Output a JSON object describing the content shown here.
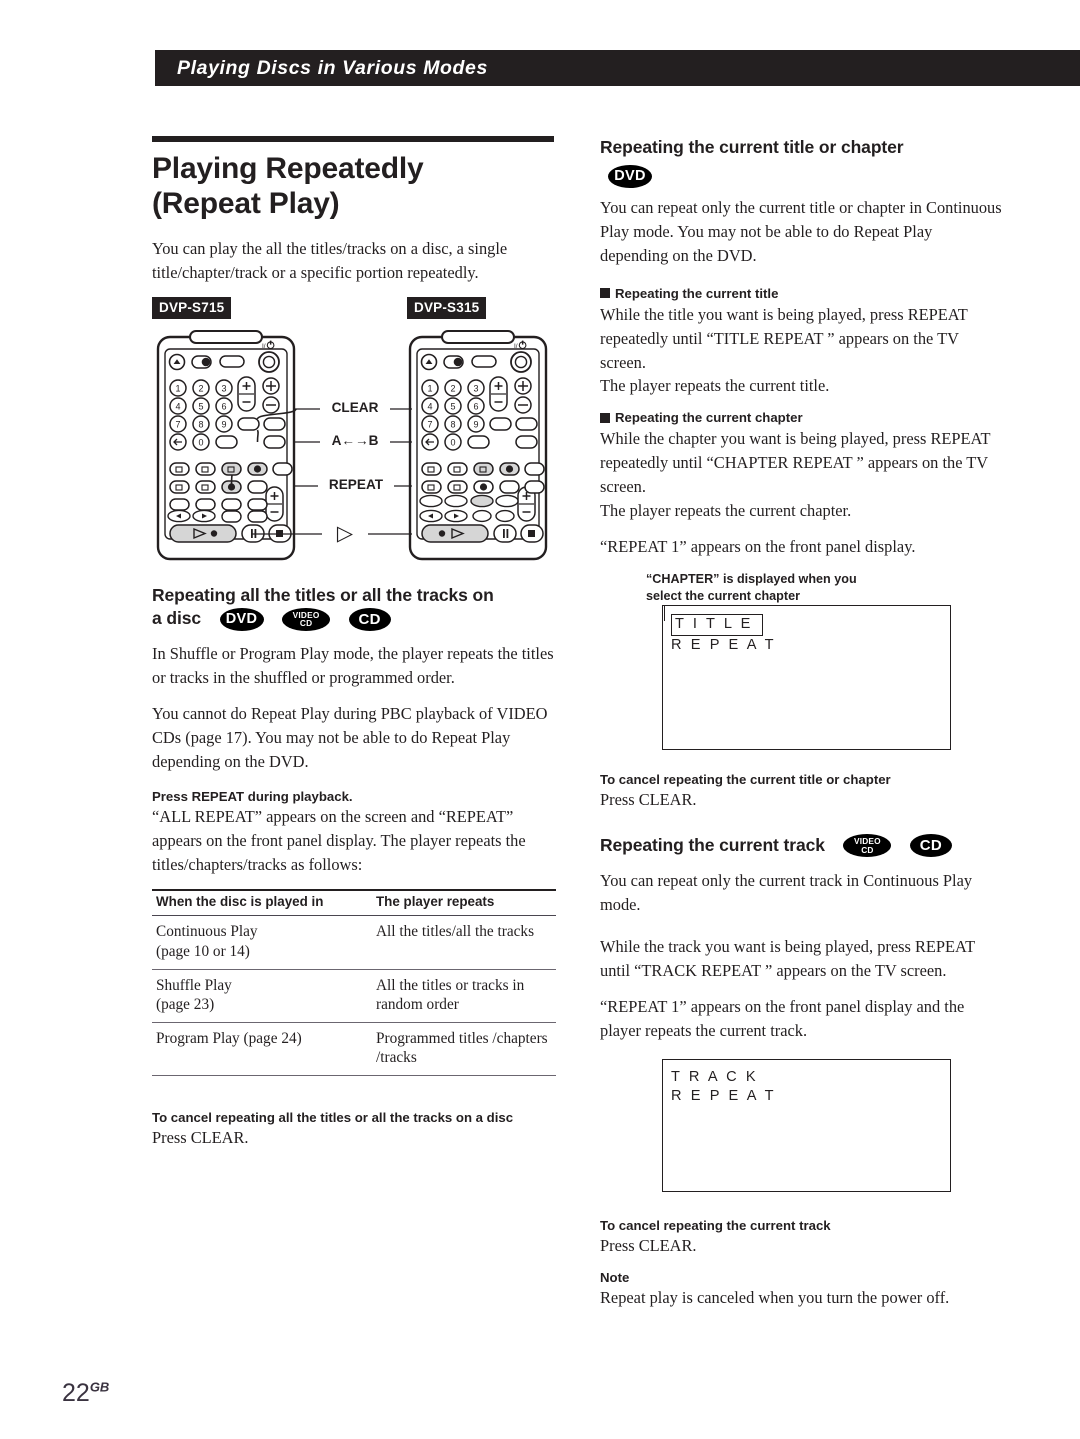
{
  "running_head": "Playing Discs in Various Modes",
  "page_number": "22",
  "page_number_suffix": "GB",
  "left": {
    "title_line1": "Playing Repeatedly",
    "title_line2": "(Repeat Play)",
    "intro": "You can play the all the titles/tracks on a disc, a single title/chapter/track or a specific portion repeatedly.",
    "model_left": "DVP-S715",
    "model_right": "DVP-S315",
    "callouts": [
      "CLEAR",
      "A←→B",
      "REPEAT",
      "▷"
    ],
    "section_all": {
      "heading_line1": "Repeating all the titles or all the tracks on",
      "heading_line2": "a disc",
      "badges": [
        "DVD",
        "VIDEO CD",
        "CD"
      ],
      "para1": "In Shuffle or Program Play mode, the player repeats the titles or tracks in the shuffled or programmed order.",
      "para2": "You cannot do Repeat Play during PBC playback of VIDEO CDs (page 17).  You may not be able to do Repeat Play depending on the DVD.",
      "lead": "Press REPEAT during playback.",
      "para3": "“ALL REPEAT” appears on the screen and “REPEAT” appears on the front panel display. The player repeats the titles/chapters/tracks as follows:",
      "table": {
        "headers": [
          "When the disc is played in",
          "The player repeats"
        ],
        "rows": [
          [
            "Continuous Play\n(page 10 or 14)",
            "All the titles/all the tracks"
          ],
          [
            "Shuffle Play\n(page 23)",
            "All the titles or tracks in\nrandom order"
          ],
          [
            "Program Play (page 24)",
            "Programmed titles /chapters\n/tracks"
          ]
        ]
      },
      "cancel_head": "To cancel repeating all the titles or all the tracks on a disc",
      "cancel_body": "Press CLEAR."
    }
  },
  "right": {
    "section_title_chapter": {
      "heading": "Repeating the current title or chapter",
      "badge": "DVD",
      "para1": "You can repeat only the current title or chapter in Continuous Play mode.  You may not be able to do Repeat Play depending on the DVD.",
      "bullet1_head": "Repeating the current title",
      "bullet1_body1": "While the title you want is being played, press REPEAT repeatedly until “TITLE REPEAT ” appears on the TV screen.",
      "bullet1_body2": "The player repeats the current title.",
      "bullet2_head": "Repeating the current chapter",
      "bullet2_body1": "While the chapter you want is being played, press REPEAT repeatedly until “CHAPTER REPEAT ” appears on the TV screen.",
      "bullet2_body2": "The player repeats the current chapter.",
      "para2": "“REPEAT 1” appears on the front panel display.",
      "callout_line1": "“CHAPTER” is displayed when you",
      "callout_line2": "select the current chapter",
      "osd_line1": "T I T L E",
      "osd_line2": "R E P E A T",
      "cancel_head": "To cancel repeating the current title or chapter",
      "cancel_body": "Press CLEAR."
    },
    "section_track": {
      "heading": "Repeating the current track",
      "badges": [
        "VIDEO CD",
        "CD"
      ],
      "para1": "You can repeat only the current track in Continuous Play mode.",
      "para2": "While the track you want is being played, press REPEAT until “TRACK REPEAT ” appears on the TV screen.",
      "para3": "“REPEAT 1” appears on the front panel display and the player repeats the current track.",
      "osd_line1": "T R A C K",
      "osd_line2": "R E P E A T",
      "cancel_head": "To cancel repeating the current track",
      "cancel_body": "Press CLEAR.",
      "note_head": "Note",
      "note_body": "Repeat play is canceled when you turn the power off."
    }
  }
}
